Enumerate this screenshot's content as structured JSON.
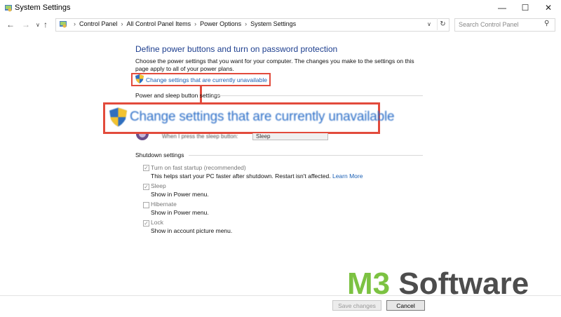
{
  "window": {
    "title": "System Settings"
  },
  "nav": {
    "breadcrumb": [
      "Control Panel",
      "All Control Panel Items",
      "Power Options",
      "System Settings"
    ],
    "search_placeholder": "Search Control Panel"
  },
  "content": {
    "heading": "Define power buttons and turn on password protection",
    "description": "Choose the power settings that you want for your computer. The changes you make to the settings on this page apply to all of your power plans.",
    "change_link": "Change settings that are currently unavailable",
    "power_section": "Power and sleep button settings",
    "sleep_row_label": "When I press the sleep button:",
    "sleep_row_value": "Sleep",
    "shutdown_section": "Shutdown settings",
    "options": [
      {
        "label": "Turn on fast startup (recommended)",
        "description": "This helps start your PC faster after shutdown. Restart isn't affected.",
        "link": "Learn More",
        "checked": true
      },
      {
        "label": "Sleep",
        "description": "Show in Power menu.",
        "checked": true
      },
      {
        "label": "Hibernate",
        "description": "Show in Power menu.",
        "checked": false
      },
      {
        "label": "Lock",
        "description": "Show in account picture menu.",
        "checked": true
      }
    ]
  },
  "footer": {
    "save_label": "Save changes",
    "cancel_label": "Cancel"
  },
  "highlight": {
    "zoomed_link": "Change settings that are currently unavailable",
    "color": "#e24b3c"
  },
  "watermark": {
    "part1": "M3",
    "part2": " Software",
    "color1": "#7cc242",
    "color2": "#4d4d4d"
  },
  "icons": [
    "control-panel-icon",
    "minimize-icon",
    "maximize-icon",
    "close-icon",
    "back-arrow-icon",
    "forward-arrow-icon",
    "dropdown-icon",
    "up-arrow-icon",
    "refresh-icon",
    "search-icon",
    "uac-shield-icon",
    "sleep-button-icon"
  ]
}
